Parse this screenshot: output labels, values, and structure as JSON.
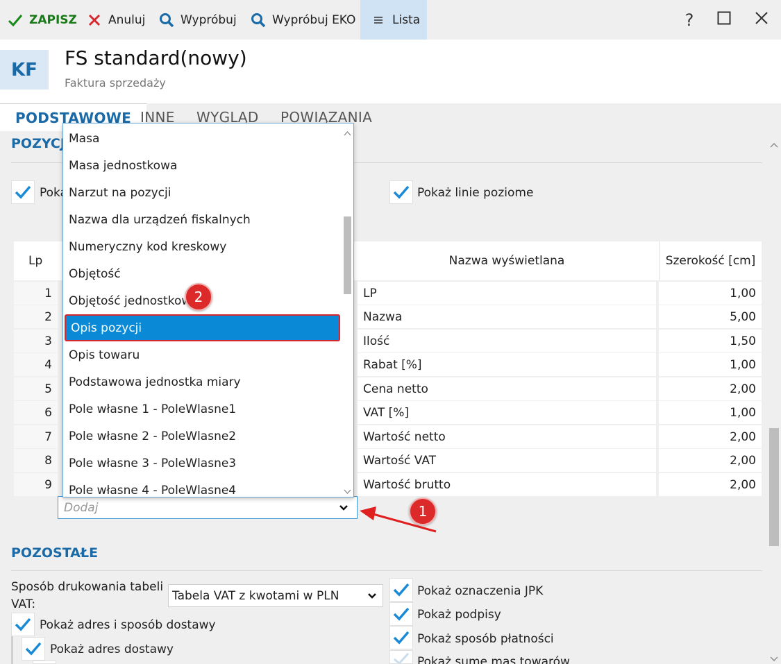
{
  "toolbar": {
    "save": "ZAPISZ",
    "cancel": "Anuluj",
    "try": "Wypróbuj",
    "try_eko": "Wypróbuj EKO",
    "list": "Lista",
    "help": "?"
  },
  "header": {
    "badge": "KF",
    "title": "FS standard(nowy)",
    "subtitle": "Faktura sprzedaży"
  },
  "tabs": [
    "PODSTAWOWE",
    "INNE",
    "WYGLĄD",
    "POWIĄZANIA"
  ],
  "positions": {
    "section_title": "POZYCJE",
    "show_left_partial": "Pokaż",
    "show_horizontal": "Pokaż linie poziome",
    "columns": {
      "lp": "Lp",
      "display_name": "Nazwa wyświetlana",
      "width": "Szerokość [cm]"
    },
    "rows": [
      {
        "lp": "1",
        "name": "LP",
        "width": "1,00"
      },
      {
        "lp": "2",
        "name": "Nazwa",
        "width": "5,00"
      },
      {
        "lp": "3",
        "name": "Ilość",
        "width": "1,50"
      },
      {
        "lp": "4",
        "name": "Rabat [%]",
        "width": "1,00"
      },
      {
        "lp": "5",
        "name": "Cena netto",
        "width": "2,00"
      },
      {
        "lp": "6",
        "name": "VAT [%]",
        "width": "1,00"
      },
      {
        "lp": "7",
        "name": "Wartość netto",
        "width": "2,00"
      },
      {
        "lp": "8",
        "name": "Wartość VAT",
        "width": "2,00"
      },
      {
        "lp": "9",
        "name": "Wartość brutto",
        "width": "2,00"
      }
    ],
    "add_placeholder": "Dodaj"
  },
  "dropdown": {
    "items": [
      "Masa",
      "Masa jednostkowa",
      "Narzut na pozycji",
      "Nazwa dla urządzeń fiskalnych",
      "Numeryczny kod kreskowy",
      "Objętość",
      "Objętość jednostkowa",
      "Opis pozycji",
      "Opis towaru",
      "Podstawowa jednostka miary",
      "Pole własne 1 - PoleWlasne1",
      "Pole własne 2 - PoleWlasne2",
      "Pole własne 3 - PoleWlasne3",
      "Pole własne 4 - PoleWlasne4"
    ],
    "selected": "Opis pozycji"
  },
  "markers": {
    "one": "1",
    "two": "2"
  },
  "other": {
    "section_title": "POZOSTAŁE",
    "vat_table_label_1": "Sposób drukowania tabeli",
    "vat_table_label_2": "VAT:",
    "vat_table_value": "Tabela VAT z kwotami w PLN",
    "show_address_delivery": "Pokaż adres i sposób dostawy",
    "show_delivery_address": "Pokaż adres dostawy",
    "show_jpk": "Pokaż oznaczenia JPK",
    "show_signatures": "Pokaż podpisy",
    "show_payment": "Pokaż sposób płatności",
    "show_mass": "Pokaż sumę mas towarów"
  }
}
